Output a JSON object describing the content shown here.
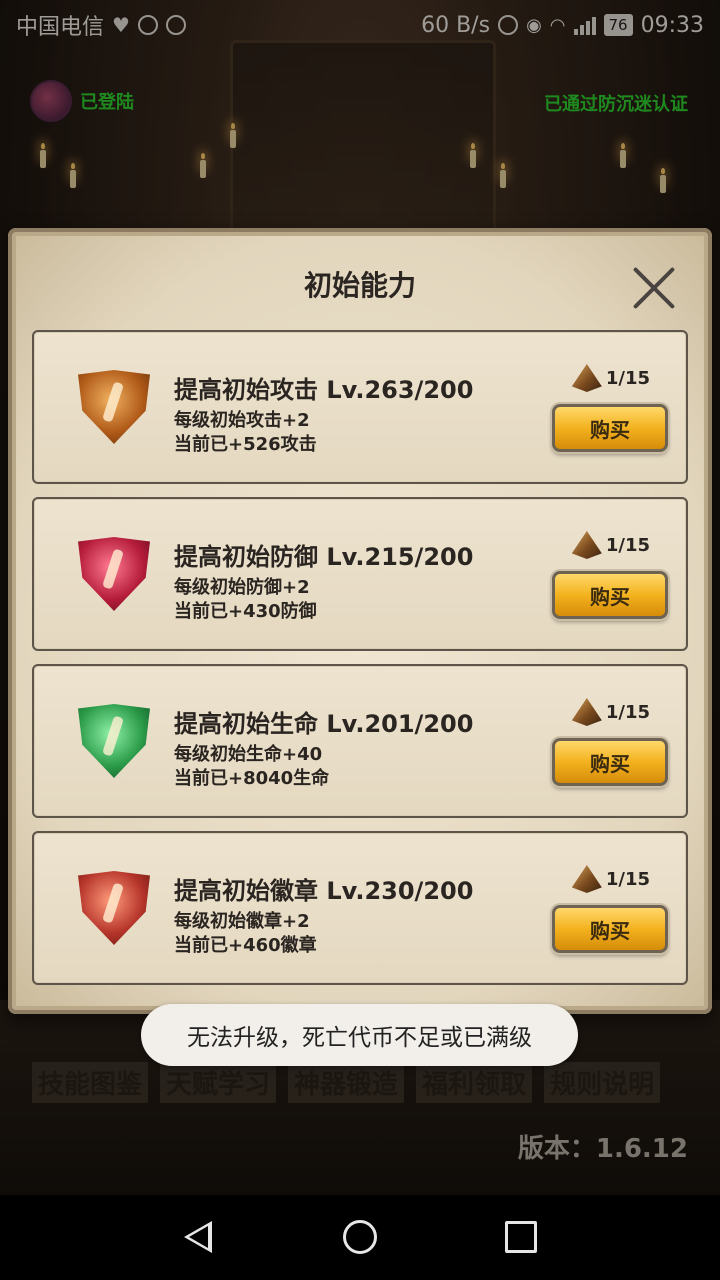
{
  "status_bar": {
    "carrier": "中国电信",
    "net_speed": "60 B/s",
    "battery": "76",
    "network_type": "4G",
    "time": "09:33"
  },
  "header": {
    "login_status": "已登陆",
    "anti_addiction_status": "已通过防沉迷认证"
  },
  "modal": {
    "title": "初始能力",
    "items": [
      {
        "title": "提高初始攻击 Lv.263/200",
        "desc_per_level": "每级初始攻击+2",
        "desc_current": "当前已+526攻击",
        "cost": "1/15",
        "buy_label": "购买",
        "icon": "attack-gem-icon"
      },
      {
        "title": "提高初始防御 Lv.215/200",
        "desc_per_level": "每级初始防御+2",
        "desc_current": "当前已+430防御",
        "cost": "1/15",
        "buy_label": "购买",
        "icon": "defense-gem-icon"
      },
      {
        "title": "提高初始生命 Lv.201/200",
        "desc_per_level": "每级初始生命+40",
        "desc_current": "当前已+8040生命",
        "cost": "1/15",
        "buy_label": "购买",
        "icon": "health-gem-icon"
      },
      {
        "title": "提高初始徽章 Lv.230/200",
        "desc_per_level": "每级初始徽章+2",
        "desc_current": "当前已+460徽章",
        "cost": "1/15",
        "buy_label": "购买",
        "icon": "badge-gem-icon"
      }
    ]
  },
  "bottom_menu": [
    "技能图鉴",
    "天赋学习",
    "神器锻造",
    "福利领取",
    "规则说明"
  ],
  "version": "版本：1.6.12",
  "toast": "无法升级，死亡代币不足或已满级",
  "colors": {
    "status_green": "#2fd32f",
    "buy_button": "#f3b21e",
    "panel_parchment": "#e8dcc4"
  }
}
